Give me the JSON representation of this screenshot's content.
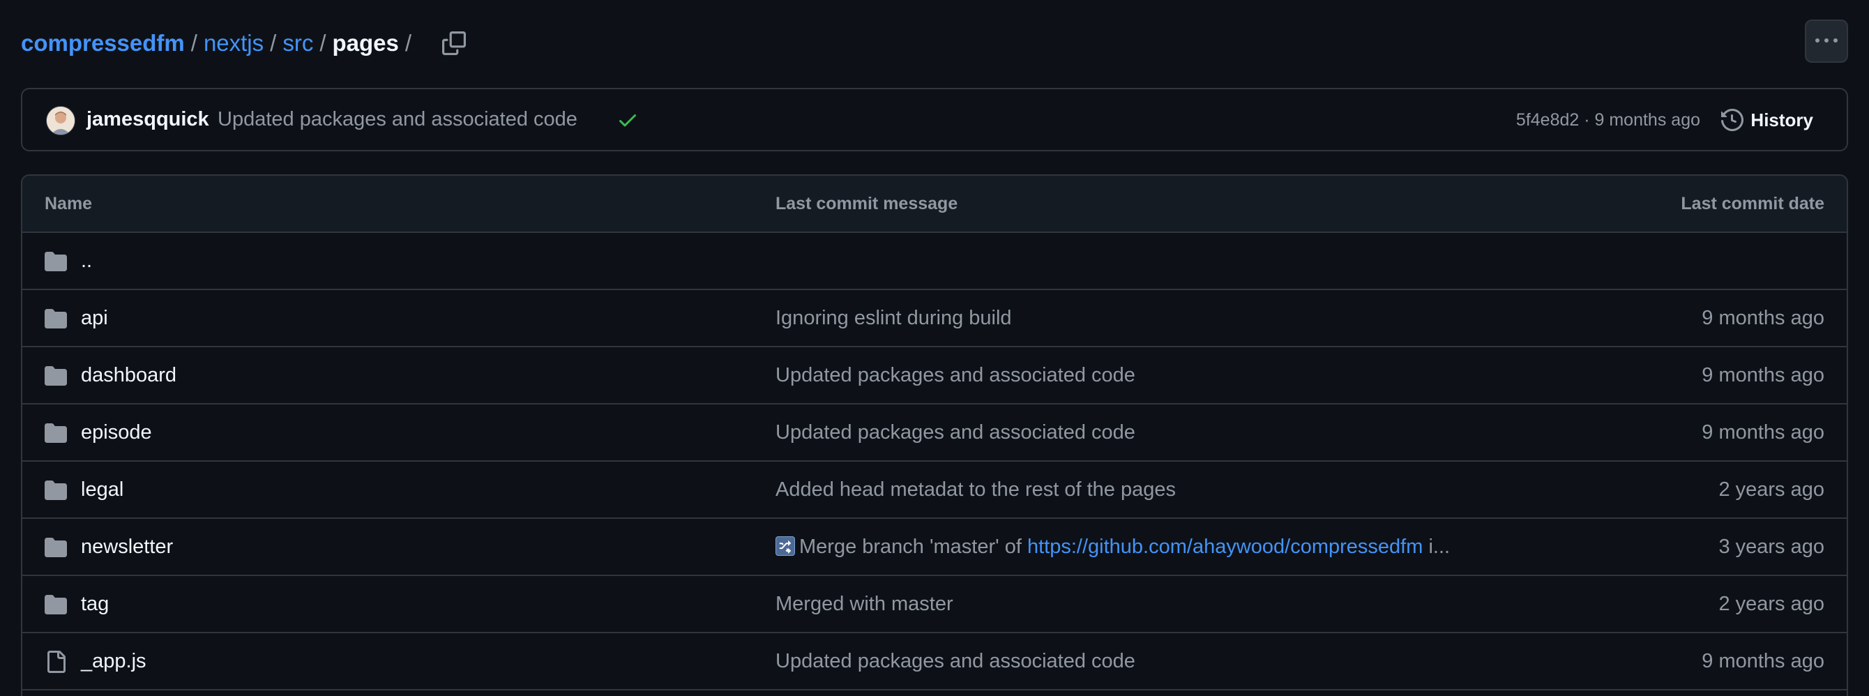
{
  "breadcrumb": {
    "repo": "compressedfm",
    "sep": "/",
    "path": [
      "nextjs",
      "src"
    ],
    "current": "pages"
  },
  "commit": {
    "author": "jamesqquick",
    "message": "Updated packages and associated code",
    "meta": "5f4e8d2 · 9 months ago",
    "history_label": "History"
  },
  "table": {
    "headers": {
      "name": "Name",
      "message": "Last commit message",
      "date": "Last commit date"
    },
    "parent": "..",
    "rows": [
      {
        "type": "folder",
        "name": "api",
        "message": "Ignoring eslint during build",
        "date": "9 months ago"
      },
      {
        "type": "folder",
        "name": "dashboard",
        "message": "Updated packages and associated code",
        "date": "9 months ago"
      },
      {
        "type": "folder",
        "name": "episode",
        "message": "Updated packages and associated code",
        "date": "9 months ago"
      },
      {
        "type": "folder",
        "name": "legal",
        "message": "Added head metadat to the rest of the pages",
        "date": "2 years ago"
      },
      {
        "type": "folder",
        "name": "newsletter",
        "message_prefix": "Merge branch 'master' of ",
        "message_link": "https://github.com/ahaywood/compressedfm",
        "message_suffix": " i...",
        "date": "3 years ago"
      },
      {
        "type": "folder",
        "name": "tag",
        "message": "Merged with master",
        "date": "2 years ago"
      },
      {
        "type": "file",
        "name": "_app.js",
        "message": "Updated packages and associated code",
        "date": "9 months ago"
      }
    ]
  },
  "icons": {
    "copy": "copy-icon",
    "more": "kebab-horizontal-icon",
    "check": "check-icon",
    "history": "history-icon",
    "folder": "folder-icon",
    "file": "file-icon"
  },
  "colors": {
    "background": "#0d1117",
    "border": "#30363d",
    "link": "#4493f8",
    "muted": "#9198a1",
    "success": "#3fb950"
  }
}
